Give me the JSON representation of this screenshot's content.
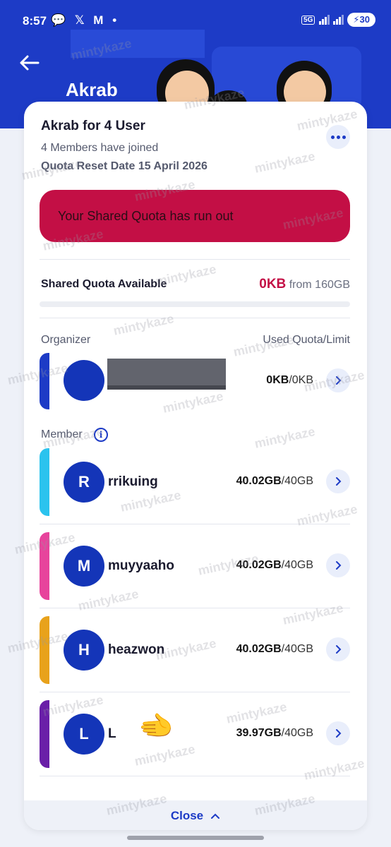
{
  "status_bar": {
    "time": "8:57",
    "left_icons": "💬 𝕏 M •",
    "network": "5G",
    "battery": "30"
  },
  "header": {
    "title": "Akrab"
  },
  "group": {
    "title": "Akrab for 4 User",
    "members_joined": "4 Members have joined",
    "reset_date": "Quota Reset Date 15 April 2026"
  },
  "alert": {
    "text": "Your Shared Quota has run out",
    "color": "#c30f45"
  },
  "shared_quota": {
    "label": "Shared Quota Available",
    "available": "0KB",
    "from_text": "from 160GB",
    "remaining_fraction": 0
  },
  "organizer_section": {
    "label": "Organizer",
    "usage_header": "Used Quota/Limit",
    "row": {
      "initial": "",
      "name": "",
      "used": "0KB",
      "limit": "/0KB",
      "bar_color": "#1d3bc6"
    }
  },
  "member_section": {
    "label": "Member",
    "info_icon": "i"
  },
  "members": [
    {
      "initial": "R",
      "name": "rrikuing",
      "used": "40.02GB",
      "limit": "/40GB",
      "bar_color": "#2bc3ee"
    },
    {
      "initial": "M",
      "name": "muyyaaho",
      "used": "40.02GB",
      "limit": "/40GB",
      "bar_color": "#e7449c"
    },
    {
      "initial": "H",
      "name": "heazwon",
      "used": "40.02GB",
      "limit": "/40GB",
      "bar_color": "#e8a21b"
    },
    {
      "initial": "L",
      "name": "L",
      "used": "39.97GB",
      "limit": "/40GB",
      "bar_color": "#6a1fa8"
    }
  ],
  "footer": {
    "close_label": "Close",
    "close_icon": "^"
  },
  "emoji": "🫲",
  "watermark": "mintykaze",
  "icons": [
    "back-arrow-icon",
    "more-dots-icon",
    "info-icon",
    "chevron-right-icon",
    "chevron-up-icon"
  ]
}
